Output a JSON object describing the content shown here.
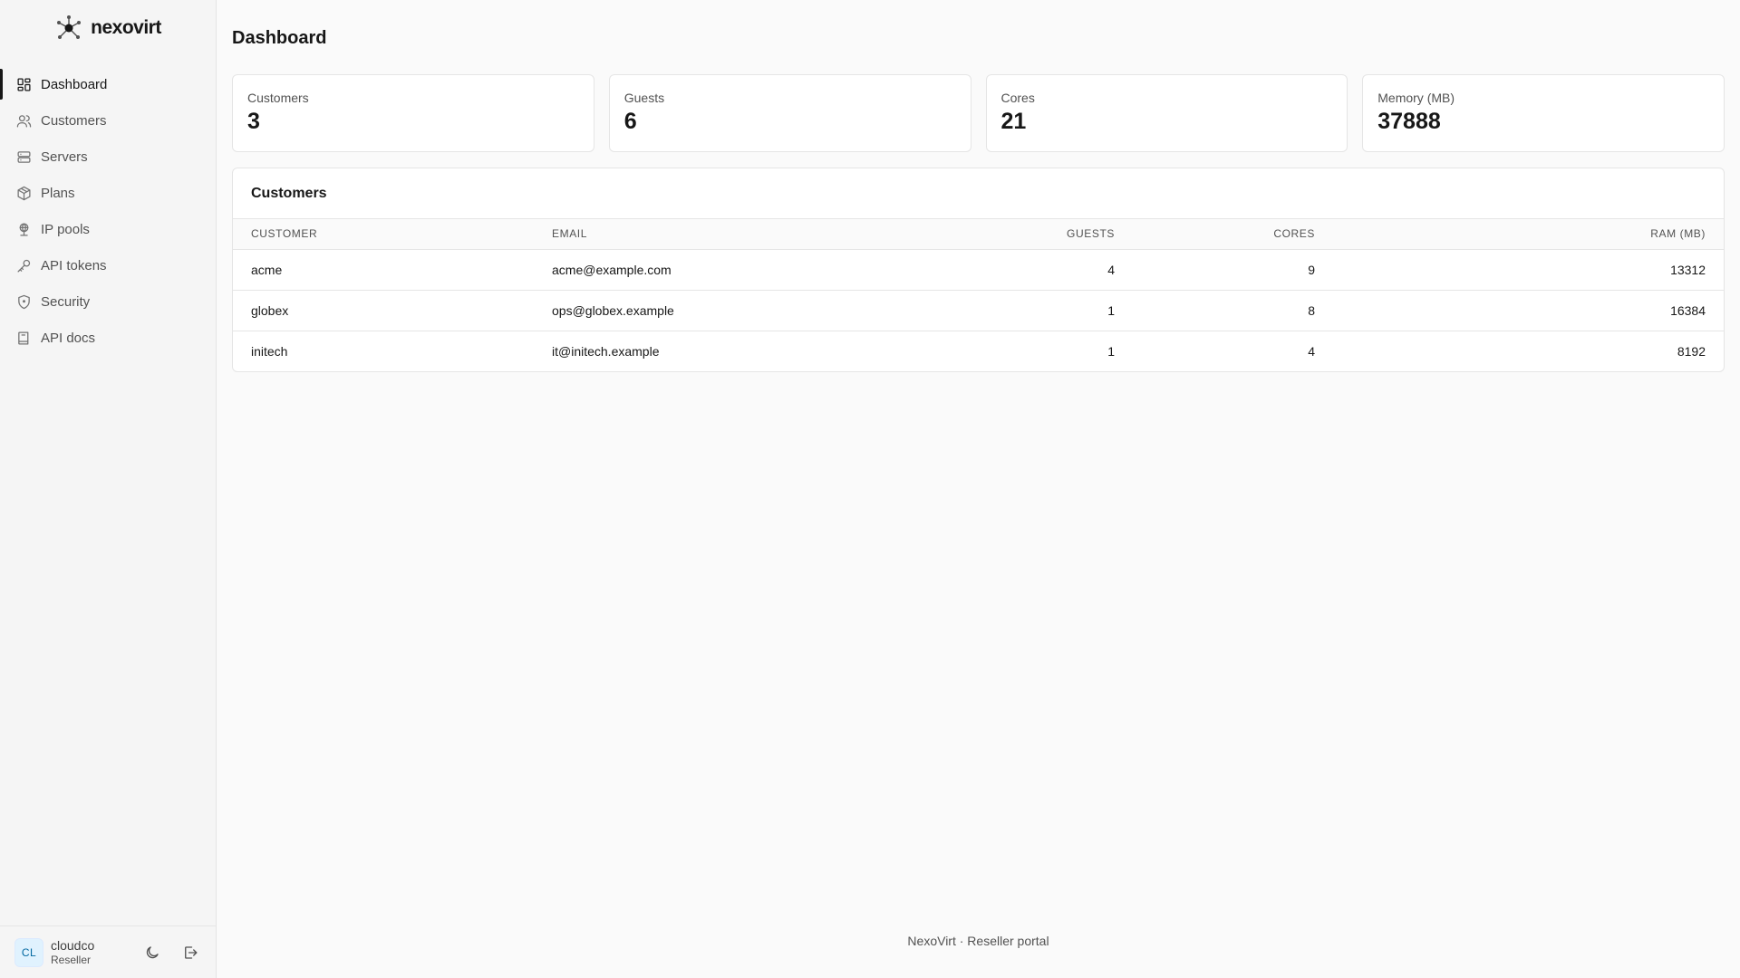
{
  "brand": {
    "name": "nexovirt"
  },
  "sidebar": {
    "items": [
      {
        "label": "Dashboard",
        "icon": "dashboard-icon",
        "active": true
      },
      {
        "label": "Customers",
        "icon": "users-icon"
      },
      {
        "label": "Servers",
        "icon": "server-icon"
      },
      {
        "label": "Plans",
        "icon": "package-icon"
      },
      {
        "label": "IP pools",
        "icon": "globe-network-icon"
      },
      {
        "label": "API tokens",
        "icon": "key-icon"
      },
      {
        "label": "Security",
        "icon": "shield-icon"
      },
      {
        "label": "API docs",
        "icon": "book-icon"
      }
    ]
  },
  "user": {
    "initials": "CL",
    "name": "cloudco",
    "role": "Reseller"
  },
  "page": {
    "title": "Dashboard"
  },
  "stats": [
    {
      "label": "Customers",
      "value": "3"
    },
    {
      "label": "Guests",
      "value": "6"
    },
    {
      "label": "Cores",
      "value": "21"
    },
    {
      "label": "Memory (MB)",
      "value": "37888"
    }
  ],
  "customers_panel": {
    "title": "Customers",
    "columns": [
      "CUSTOMER",
      "EMAIL",
      "GUESTS",
      "CORES",
      "RAM (MB)"
    ],
    "rows": [
      {
        "customer": "acme",
        "email": "acme@example.com",
        "guests": "4",
        "cores": "9",
        "ram": "13312"
      },
      {
        "customer": "globex",
        "email": "ops@globex.example",
        "guests": "1",
        "cores": "8",
        "ram": "16384"
      },
      {
        "customer": "initech",
        "email": "it@initech.example",
        "guests": "1",
        "cores": "4",
        "ram": "8192"
      }
    ]
  },
  "footer": {
    "text": "NexoVirt · Reseller portal"
  },
  "colors": {
    "accent": "#171717",
    "avatar_bg": "#e0f2fe",
    "avatar_text": "#0369a1"
  }
}
